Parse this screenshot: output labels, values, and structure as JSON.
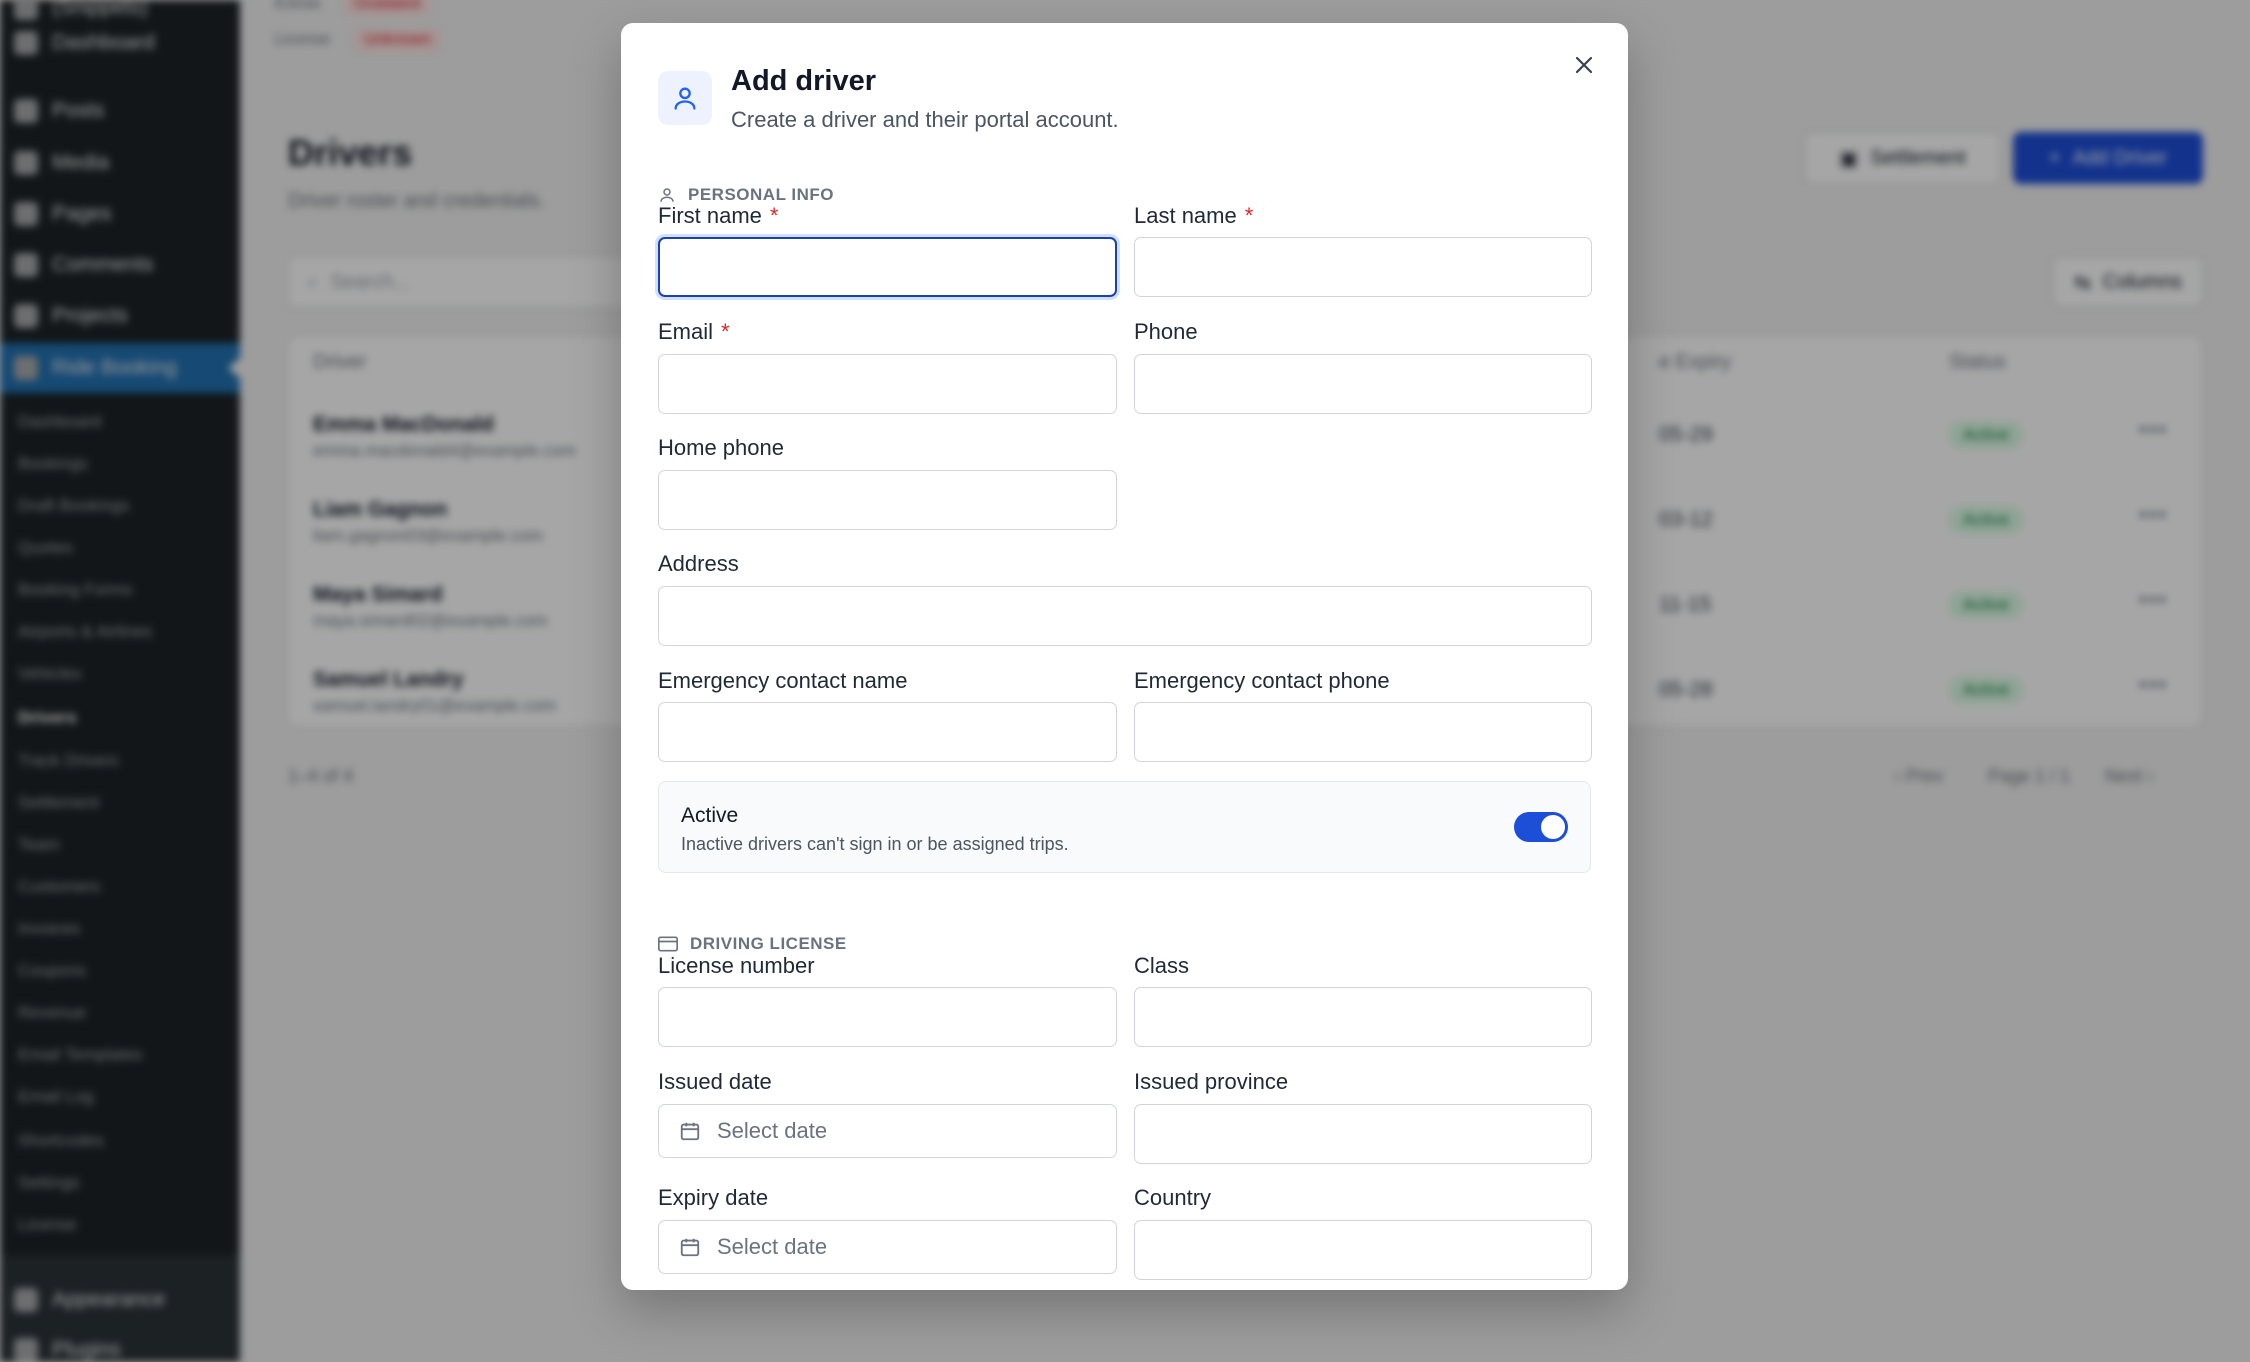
{
  "background": {
    "sidebar_top": [
      {
        "label": "(Snippets)"
      },
      {
        "label": "Dashboard"
      },
      {
        "label": "Posts"
      },
      {
        "label": "Media"
      },
      {
        "label": "Pages"
      },
      {
        "label": "Comments"
      },
      {
        "label": "Projects"
      },
      {
        "label": "Ride Booking"
      }
    ],
    "sidebar_sub": [
      "Dashboard",
      "Bookings",
      "Draft Bookings",
      "Quotes",
      "Booking Forms",
      "Airports & Airlines",
      "Vehicles",
      "Drivers",
      "Track Drivers",
      "Settlement",
      "Team",
      "Customers",
      "Invoices",
      "Coupons",
      "Revenue",
      "Email Templates",
      "Email Log",
      "Shortcodes",
      "Settings",
      "License"
    ],
    "sidebar_bottom": [
      {
        "label": "Appearance"
      },
      {
        "label": "Plugins"
      }
    ],
    "status_lines": [
      {
        "key": "Extras",
        "value": "Outdated"
      },
      {
        "key": "License",
        "value": "Unknown"
      }
    ],
    "page_title": "Drivers",
    "page_subtitle": "Driver roster and credentials.",
    "settlement_button": "Settlement",
    "add_driver_button": "Add Driver",
    "search_placeholder": "Search...",
    "columns_button": "Columns",
    "table_headers": {
      "driver": "Driver",
      "expiry": "e Expiry",
      "status": "Status"
    },
    "rows": [
      {
        "name": "Emma MacDonald",
        "email": "emma.macdonald4@example.com",
        "expiry": "05-29",
        "status": "Active"
      },
      {
        "name": "Liam Gagnon",
        "email": "liam.gagnon03@example.com",
        "expiry": "03-12",
        "status": "Active"
      },
      {
        "name": "Maya Simard",
        "email": "maya.simard02@example.com",
        "expiry": "11-15",
        "status": "Active"
      },
      {
        "name": "Samuel Landry",
        "email": "samuel.landry01@example.com",
        "expiry": "05-28",
        "status": "Active"
      }
    ],
    "count_text": "1–4 of 4",
    "pagination": {
      "prev": "Prev",
      "page": "Page 1 / 1",
      "next": "Next"
    }
  },
  "modal": {
    "title": "Add driver",
    "description": "Create a driver and their portal account.",
    "personal_section": "PERSONAL INFO",
    "license_section": "DRIVING LICENSE",
    "required_mark": "*",
    "fields": {
      "first_name": {
        "label": "First name",
        "value": ""
      },
      "last_name": {
        "label": "Last name",
        "value": ""
      },
      "email": {
        "label": "Email",
        "value": ""
      },
      "phone": {
        "label": "Phone",
        "value": ""
      },
      "home_phone": {
        "label": "Home phone",
        "value": ""
      },
      "address": {
        "label": "Address",
        "value": ""
      },
      "emergency_name": {
        "label": "Emergency contact name",
        "value": ""
      },
      "emergency_phone": {
        "label": "Emergency contact phone",
        "value": ""
      },
      "license_number": {
        "label": "License number",
        "value": ""
      },
      "class": {
        "label": "Class",
        "value": ""
      },
      "issued_date": {
        "label": "Issued date",
        "placeholder": "Select date"
      },
      "issued_province": {
        "label": "Issued province",
        "value": ""
      },
      "expiry_date": {
        "label": "Expiry date",
        "placeholder": "Select date"
      },
      "country": {
        "label": "Country",
        "value": ""
      }
    },
    "active_toggle": {
      "title": "Active",
      "description": "Inactive drivers can't sign in or be assigned trips.",
      "on": true
    }
  },
  "colors": {
    "accent": "#1d4ed8",
    "required": "#dc2626",
    "active_badge": "#15803d"
  },
  "icons": {
    "close": "close-icon",
    "header": "user-icon",
    "personal": "user-outline-icon",
    "license": "credit-card-icon",
    "calendar": "calendar-icon"
  }
}
